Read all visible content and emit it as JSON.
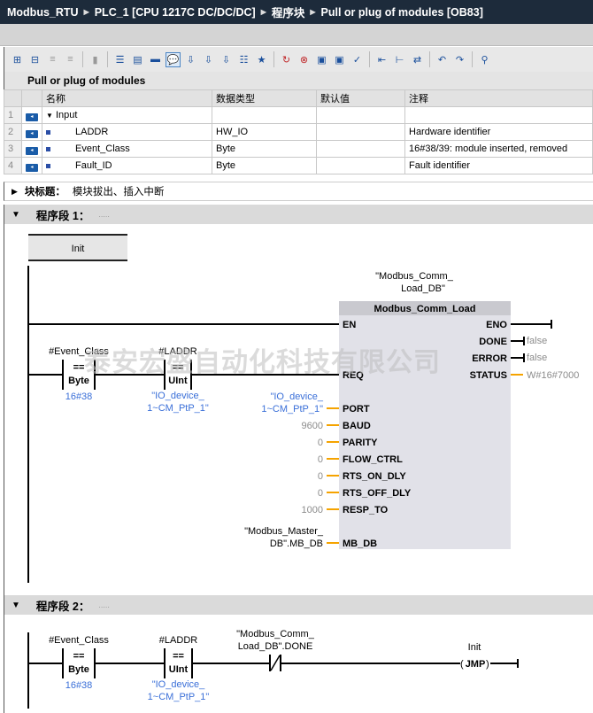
{
  "breadcrumb": [
    "Modbus_RTU",
    "PLC_1 [CPU 1217C DC/DC/DC]",
    "程序块",
    "Pull or plug of modules [OB83]"
  ],
  "toolbar_icons": [
    "insert-row-icon",
    "delete-row-icon",
    "insert-network-icon",
    "delete-network-icon",
    "move-icon",
    "toggle-absolute-icon",
    "networks-icon",
    "show-favorites-icon",
    "comments-icon",
    "open-all-networks-icon",
    "close-all-networks-icon",
    "goto-network-icon",
    "zoom-icon",
    "favorites-icon",
    "monitor-on-icon",
    "monitor-off-icon",
    "download-icon",
    "upload-icon",
    "check-icon",
    "expand-icon",
    "collapse-icon",
    "rearrange-icon",
    "goto-previous-icon",
    "goto-next-icon",
    "search-icon"
  ],
  "block": {
    "title": "Pull or plug of modules",
    "columns": [
      "名称",
      "数据类型",
      "默认值",
      "注释"
    ],
    "rows": [
      {
        "num": "1",
        "name": "Input",
        "type": "",
        "default": "",
        "comment": ""
      },
      {
        "num": "2",
        "name": "LADDR",
        "type": "HW_IO",
        "default": "",
        "comment": "Hardware identifier"
      },
      {
        "num": "3",
        "name": "Event_Class",
        "type": "Byte",
        "default": "",
        "comment": "16#38/39: module inserted, removed"
      },
      {
        "num": "4",
        "name": "Fault_ID",
        "type": "Byte",
        "default": "",
        "comment": "Fault identifier"
      }
    ]
  },
  "block_title": {
    "label": "块标题：",
    "value": "模块拔出、插入中断"
  },
  "network1": {
    "label": "程序段 1：",
    "dots": ".....",
    "jump_label": "Init",
    "instance_db": [
      "\"Modbus_Comm_",
      "Load_DB\""
    ],
    "fb_name": "Modbus_Comm_Load",
    "cmp1": {
      "operand": "#Event_Class",
      "op": "==",
      "type": "Byte",
      "value": "16#38"
    },
    "cmp2": {
      "operand": "#LADDR",
      "op": "==",
      "type": "UInt",
      "value": [
        "\"IO_device_",
        "1~CM_PtP_1\""
      ]
    },
    "inputs": {
      "EN": "EN",
      "REQ": "REQ",
      "PORT": "PORT",
      "BAUD": "BAUD",
      "PARITY": "PARITY",
      "FLOW_CTRL": "FLOW_CTRL",
      "RTS_ON_DLY": "RTS_ON_DLY",
      "RTS_OFF_DLY": "RTS_OFF_DLY",
      "RESP_TO": "RESP_TO",
      "MB_DB": "MB_DB"
    },
    "outputs": {
      "ENO": "ENO",
      "DONE": "DONE",
      "ERROR": "ERROR",
      "STATUS": "STATUS"
    },
    "values": {
      "PORT": [
        "\"IO_device_",
        "1~CM_PtP_1\""
      ],
      "BAUD": "9600",
      "PARITY": "0",
      "FLOW_CTRL": "0",
      "RTS_ON_DLY": "0",
      "RTS_OFF_DLY": "0",
      "RESP_TO": "1000",
      "MB_DB": [
        "\"Modbus_Master_",
        "DB\".MB_DB"
      ],
      "DONE": "false",
      "ERROR": "false",
      "STATUS": "W#16#7000"
    }
  },
  "network2": {
    "label": "程序段 2：",
    "dots": ".....",
    "cmp1": {
      "operand": "#Event_Class",
      "op": "==",
      "type": "Byte",
      "value": "16#38"
    },
    "cmp2": {
      "operand": "#LADDR",
      "op": "==",
      "type": "UInt",
      "value": [
        "\"IO_device_",
        "1~CM_PtP_1\""
      ]
    },
    "contact": [
      "\"Modbus_Comm_",
      "Load_DB\".DONE"
    ],
    "jmp": {
      "label": "Init",
      "coil": "JMP"
    }
  },
  "watermark": "泰安宏盛自动化科技有限公司",
  "colors": {
    "title_bg": "#1d2b3b",
    "wire_param": "#f5a300",
    "param_blue": "#3a6fd8",
    "value_gray": "#8c8c8c",
    "fb_bg": "#e1e1e8"
  }
}
